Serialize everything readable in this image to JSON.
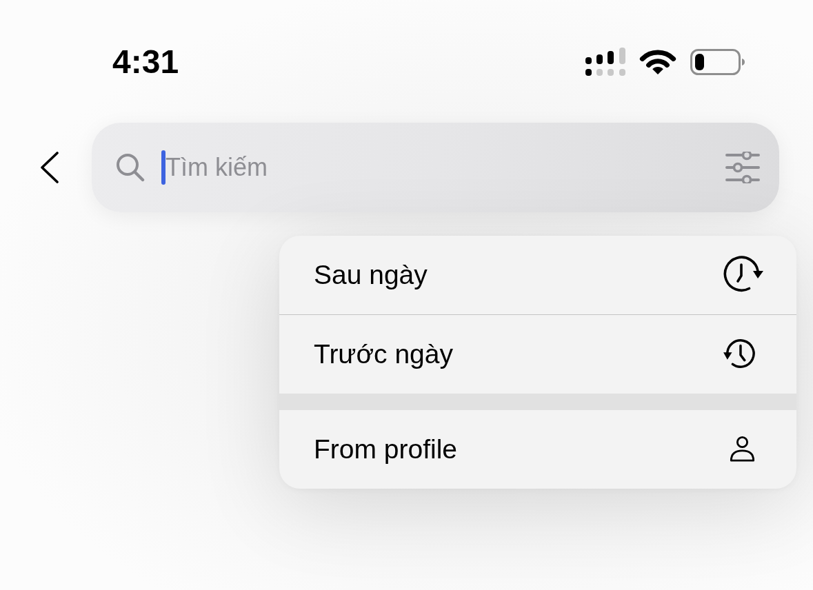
{
  "status_bar": {
    "time": "4:31"
  },
  "search": {
    "placeholder": "Tìm kiếm",
    "focused": true
  },
  "menu": {
    "groups": [
      {
        "items": [
          {
            "label": "Sau ngày"
          },
          {
            "label": "Trước ngày"
          }
        ]
      },
      {
        "items": [
          {
            "label": "From profile"
          }
        ]
      }
    ]
  }
}
